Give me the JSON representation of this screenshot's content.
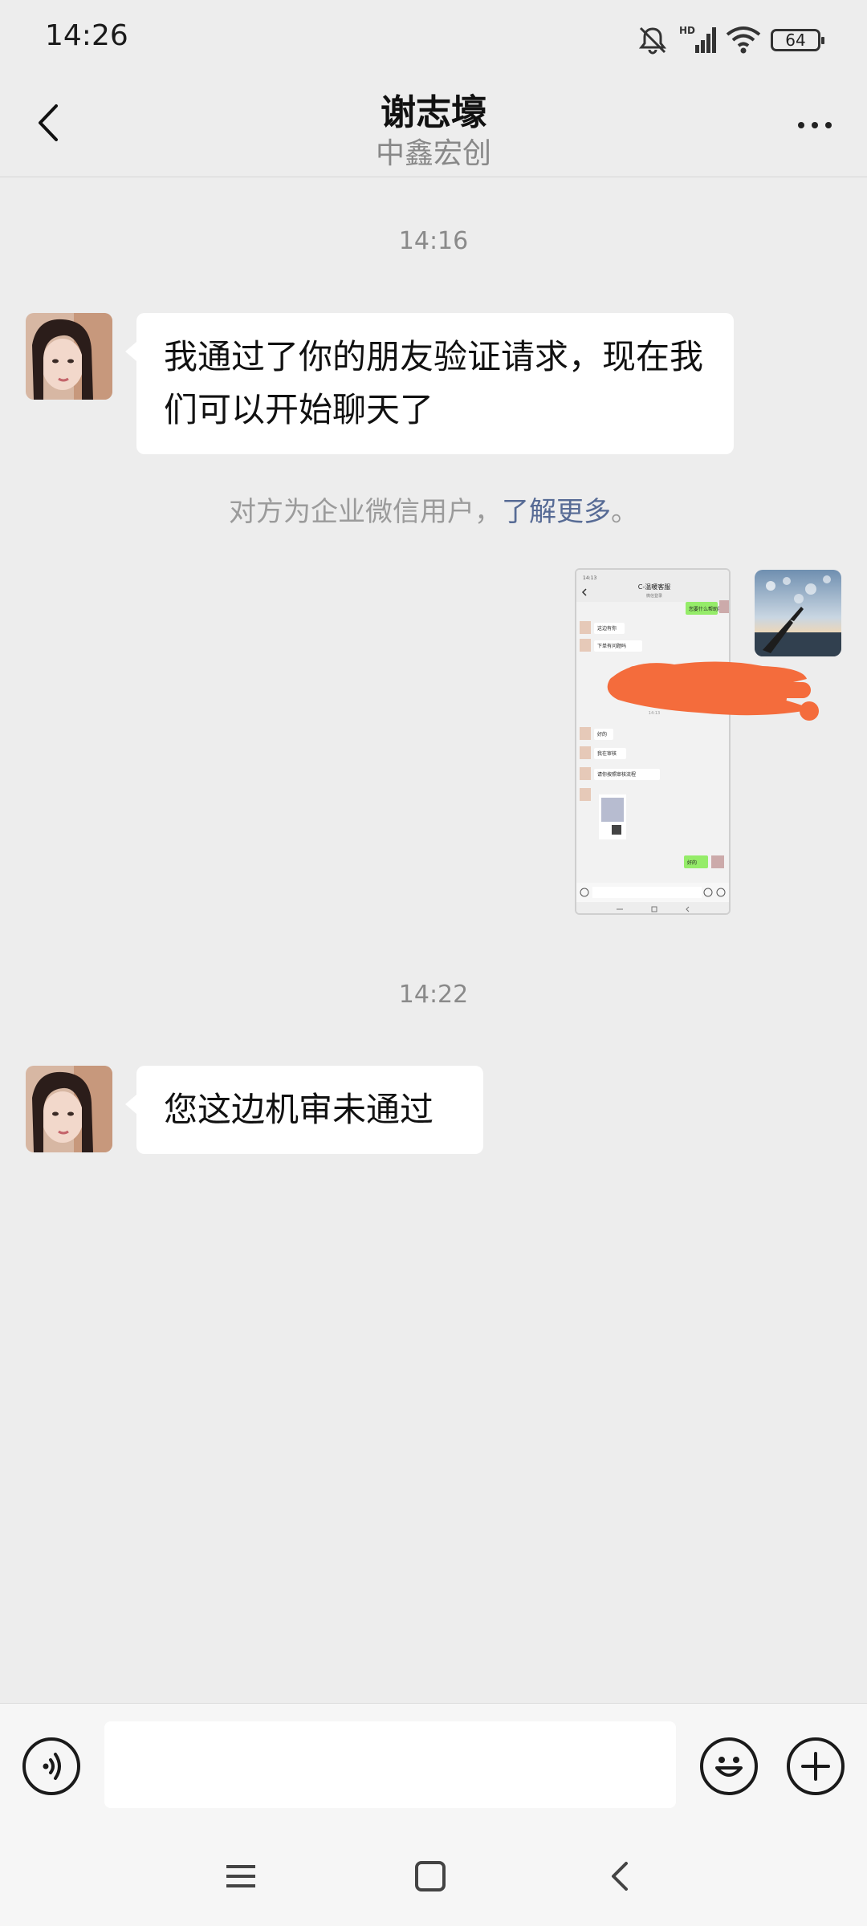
{
  "status_bar": {
    "time": "14:26",
    "battery": "64",
    "hd_label": "HD"
  },
  "header": {
    "title": "谢志壕",
    "subtitle": "中鑫宏创"
  },
  "messages": [
    {
      "timestamp": "14:16",
      "text": "我通过了你的朋友验证请求，现在我们可以开始聊天了"
    },
    {
      "timestamp": "14:22",
      "text": "您这边机审未通过"
    }
  ],
  "notice": {
    "text": "对方为企业微信用户，",
    "link": "了解更多",
    "suffix": "。"
  },
  "screenshot": {
    "header": "C-温暖客服",
    "sub": "微信登录",
    "msgs": [
      "您要什么帮助服务",
      "这边有你",
      "下单有问题吗",
      "14:13",
      "好的",
      "我在审核",
      "请你按照审核流程",
      "好的"
    ]
  },
  "input": {
    "placeholder": ""
  },
  "icons": {
    "back": "back-arrow-icon",
    "more": "more-dots-icon",
    "voice": "voice-icon",
    "emoji": "emoji-icon",
    "plus": "plus-icon",
    "menu": "menu-icon",
    "home": "home-icon",
    "nav_back": "nav-back-icon"
  },
  "colors": {
    "background": "#ededed",
    "link": "#576b95",
    "redact": "#f46c3c",
    "wechat_green": "#95ec69"
  }
}
